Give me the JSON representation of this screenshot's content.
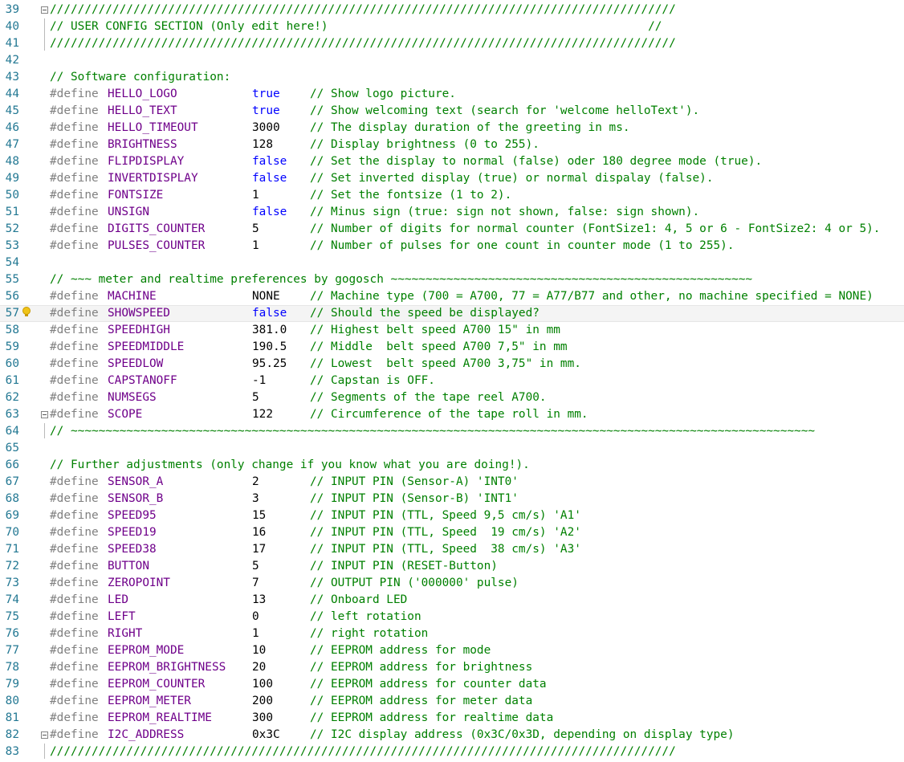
{
  "editor": {
    "highlighted_line": 57,
    "lines": [
      {
        "n": "39",
        "kind": "comment",
        "text": "//////////////////////////////////////////////////////////////////////////////////////////",
        "fold": true
      },
      {
        "n": "40",
        "kind": "comment",
        "text": "// USER CONFIG SECTION (Only edit here!)                                              //"
      },
      {
        "n": "41",
        "kind": "comment",
        "text": "//////////////////////////////////////////////////////////////////////////////////////////"
      },
      {
        "n": "42",
        "kind": "blank"
      },
      {
        "n": "43",
        "kind": "comment",
        "text": "// Software configuration:"
      },
      {
        "n": "44",
        "kind": "define",
        "name": "HELLO_LOGO",
        "value": "true",
        "vtype": "bool",
        "comment": "// Show logo picture."
      },
      {
        "n": "45",
        "kind": "define",
        "name": "HELLO_TEXT",
        "value": "true",
        "vtype": "bool",
        "comment": "// Show welcoming text (search for 'welcome helloText')."
      },
      {
        "n": "46",
        "kind": "define",
        "name": "HELLO_TIMEOUT",
        "value": "3000",
        "vtype": "num",
        "comment": "// The display duration of the greeting in ms."
      },
      {
        "n": "47",
        "kind": "define",
        "name": "BRIGHTNESS",
        "value": "128",
        "vtype": "num",
        "comment": "// Display brightness (0 to 255)."
      },
      {
        "n": "48",
        "kind": "define",
        "name": "FLIPDISPLAY",
        "value": "false",
        "vtype": "bool",
        "comment": "// Set the display to normal (false) oder 180 degree mode (true)."
      },
      {
        "n": "49",
        "kind": "define",
        "name": "INVERTDISPLAY",
        "value": "false",
        "vtype": "bool",
        "comment": "// Set inverted display (true) or normal dispalay (false)."
      },
      {
        "n": "50",
        "kind": "define",
        "name": "FONTSIZE",
        "value": "1",
        "vtype": "num",
        "comment": "// Set the fontsize (1 to 2)."
      },
      {
        "n": "51",
        "kind": "define",
        "name": "UNSIGN",
        "value": "false",
        "vtype": "bool",
        "comment": "// Minus sign (true: sign not shown, false: sign shown)."
      },
      {
        "n": "52",
        "kind": "define",
        "name": "DIGITS_COUNTER",
        "value": "5",
        "vtype": "num",
        "comment": "// Number of digits for normal counter (FontSize1: 4, 5 or 6 - FontSize2: 4 or 5)."
      },
      {
        "n": "53",
        "kind": "define",
        "name": "PULSES_COUNTER",
        "value": "1",
        "vtype": "num",
        "comment": "// Number of pulses for one count in counter mode (1 to 255)."
      },
      {
        "n": "54",
        "kind": "blank"
      },
      {
        "n": "55",
        "kind": "comment",
        "text": "// ~~~ meter and realtime preferences by gogosch ~~~~~~~~~~~~~~~~~~~~~~~~~~~~~~~~~~~~~~~~~~~~~~~~~~~~"
      },
      {
        "n": "56",
        "kind": "define",
        "name": "MACHINE",
        "value": "NONE",
        "vtype": "num",
        "comment": "// Machine type (700 = A700, 77 = A77/B77 and other, no machine specified = NONE)"
      },
      {
        "n": "57",
        "kind": "define",
        "name": "SHOWSPEED",
        "value": "false",
        "vtype": "bool",
        "comment": "// Should the speed be displayed?",
        "bulb": true
      },
      {
        "n": "58",
        "kind": "define",
        "name": "SPEEDHIGH",
        "value": "381.0",
        "vtype": "num",
        "comment": "// Highest belt speed A700 15\" in mm"
      },
      {
        "n": "59",
        "kind": "define",
        "name": "SPEEDMIDDLE",
        "value": "190.5",
        "vtype": "num",
        "comment": "// Middle  belt speed A700 7,5\" in mm"
      },
      {
        "n": "60",
        "kind": "define",
        "name": "SPEEDLOW",
        "value": "95.25",
        "vtype": "num",
        "comment": "// Lowest  belt speed A700 3,75\" in mm."
      },
      {
        "n": "61",
        "kind": "define",
        "name": "CAPSTANOFF",
        "value": "-1",
        "vtype": "num",
        "comment": "// Capstan is OFF."
      },
      {
        "n": "62",
        "kind": "define",
        "name": "NUMSEGS",
        "value": "5",
        "vtype": "num",
        "comment": "// Segments of the tape reel A700."
      },
      {
        "n": "63",
        "kind": "define",
        "name": "SCOPE",
        "value": "122",
        "vtype": "num",
        "comment": "// Circumference of the tape roll in mm.",
        "fold": true
      },
      {
        "n": "64",
        "kind": "comment",
        "text": "// ~~~~~~~~~~~~~~~~~~~~~~~~~~~~~~~~~~~~~~~~~~~~~~~~~~~~~~~~~~~~~~~~~~~~~~~~~~~~~~~~~~~~~~~~~~~~~~~~~~~~~~~~~~~"
      },
      {
        "n": "65",
        "kind": "blank"
      },
      {
        "n": "66",
        "kind": "comment",
        "text": "// Further adjustments (only change if you know what you are doing!)."
      },
      {
        "n": "67",
        "kind": "define",
        "name": "SENSOR_A",
        "value": "2",
        "vtype": "num",
        "comment": "// INPUT PIN (Sensor-A) 'INT0'"
      },
      {
        "n": "68",
        "kind": "define",
        "name": "SENSOR_B",
        "value": "3",
        "vtype": "num",
        "comment": "// INPUT PIN (Sensor-B) 'INT1'"
      },
      {
        "n": "69",
        "kind": "define",
        "name": "SPEED95",
        "value": "15",
        "vtype": "num",
        "comment": "// INPUT PIN (TTL, Speed 9,5 cm/s) 'A1'"
      },
      {
        "n": "70",
        "kind": "define",
        "name": "SPEED19",
        "value": "16",
        "vtype": "num",
        "comment": "// INPUT PIN (TTL, Speed  19 cm/s) 'A2'"
      },
      {
        "n": "71",
        "kind": "define",
        "name": "SPEED38",
        "value": "17",
        "vtype": "num",
        "comment": "// INPUT PIN (TTL, Speed  38 cm/s) 'A3'"
      },
      {
        "n": "72",
        "kind": "define",
        "name": "BUTTON",
        "value": "5",
        "vtype": "num",
        "comment": "// INPUT PIN (RESET-Button)"
      },
      {
        "n": "73",
        "kind": "define",
        "name": "ZEROPOINT",
        "value": "7",
        "vtype": "num",
        "comment": "// OUTPUT PIN ('000000' pulse)"
      },
      {
        "n": "74",
        "kind": "define",
        "name": "LED",
        "value": "13",
        "vtype": "num",
        "comment": "// Onboard LED"
      },
      {
        "n": "75",
        "kind": "define",
        "name": "LEFT",
        "value": "0",
        "vtype": "num",
        "comment": "// left rotation"
      },
      {
        "n": "76",
        "kind": "define",
        "name": "RIGHT",
        "value": "1",
        "vtype": "num",
        "comment": "// right rotation"
      },
      {
        "n": "77",
        "kind": "define",
        "name": "EEPROM_MODE",
        "value": "10",
        "vtype": "num",
        "comment": "// EEPROM address for mode"
      },
      {
        "n": "78",
        "kind": "define",
        "name": "EEPROM_BRIGHTNESS",
        "value": "20",
        "vtype": "num",
        "comment": "// EEPROM address for brightness"
      },
      {
        "n": "79",
        "kind": "define",
        "name": "EEPROM_COUNTER",
        "value": "100",
        "vtype": "num",
        "comment": "// EEPROM address for counter data"
      },
      {
        "n": "80",
        "kind": "define",
        "name": "EEPROM_METER",
        "value": "200",
        "vtype": "num",
        "comment": "// EEPROM address for meter data"
      },
      {
        "n": "81",
        "kind": "define",
        "name": "EEPROM_REALTIME",
        "value": "300",
        "vtype": "num",
        "comment": "// EEPROM address for realtime data"
      },
      {
        "n": "82",
        "kind": "define",
        "name": "I2C_ADDRESS",
        "value": "0x3C",
        "vtype": "num",
        "comment": "// I2C display address (0x3C/0x3D, depending on display type)",
        "fold": true
      },
      {
        "n": "83",
        "kind": "comment",
        "text": "//////////////////////////////////////////////////////////////////////////////////////////"
      }
    ],
    "directive": "#define"
  }
}
